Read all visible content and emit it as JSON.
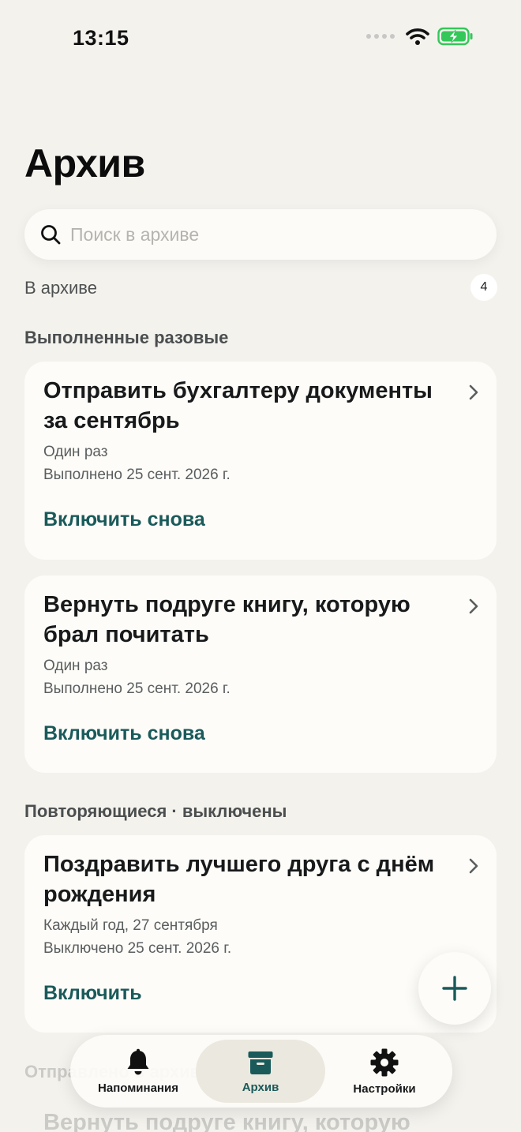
{
  "status_bar": {
    "time": "13:15"
  },
  "page": {
    "title": "Архив"
  },
  "search": {
    "placeholder": "Поиск в архиве"
  },
  "archive": {
    "label": "В архиве",
    "count": "4"
  },
  "sections": [
    {
      "label": "Выполненные разовые",
      "cards": [
        {
          "title": "Отправить бухгалтеру документы за сентябрь",
          "frequency": "Один раз",
          "status": "Выполнено 25 сент. 2026 г.",
          "action": "Включить снова"
        },
        {
          "title": "Вернуть подруге книгу, которую брал почитать",
          "frequency": "Один раз",
          "status": "Выполнено 25 сент. 2026 г.",
          "action": "Включить снова"
        }
      ]
    },
    {
      "label": "Повторяющиеся · выключены",
      "cards": [
        {
          "title": "Поздравить лучшего друга с днём рождения",
          "frequency": "Каждый год, 27 сентября",
          "status": "Выключено 25 сент. 2026 г.",
          "action": "Включить"
        }
      ]
    },
    {
      "label": "Отправлено в архив",
      "cards": [
        {
          "title": "Вернуть подруге книгу, которую"
        }
      ]
    }
  ],
  "tab_bar": {
    "tabs": [
      {
        "label": "Напоминания",
        "icon": "bell-icon"
      },
      {
        "label": "Архив",
        "icon": "archive-box-icon",
        "active": true
      },
      {
        "label": "Настройки",
        "icon": "gear-icon"
      }
    ]
  },
  "colors": {
    "background": "#f4f2ed",
    "card": "#fdfcf8",
    "accent": "#1a5a5a"
  }
}
